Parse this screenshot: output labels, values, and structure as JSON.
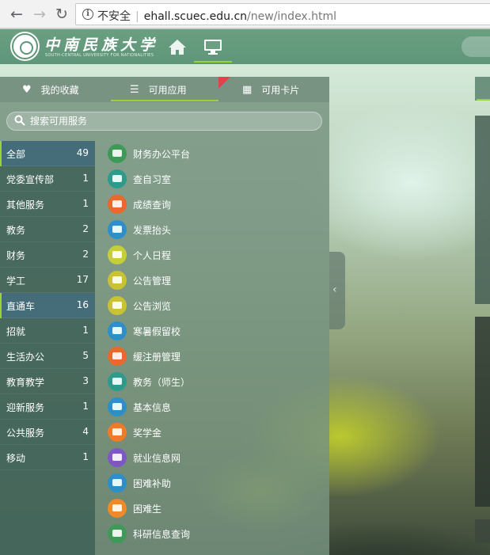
{
  "browser": {
    "security_label": "不安全",
    "url_host": "ehall.scuec.edu.cn",
    "url_path": "/new/index.html"
  },
  "header": {
    "logo_name": "中南民族大学",
    "logo_subtitle": "SOUTH-CENTRAL UNIVERSITY FOR NATIONALITIES",
    "accent_color": "#9ad23c"
  },
  "tabs": [
    {
      "label": "我的收藏",
      "icon": "heart-icon"
    },
    {
      "label": "可用应用",
      "icon": "list-icon",
      "active": true
    },
    {
      "label": "可用卡片",
      "icon": "grid-icon"
    }
  ],
  "search": {
    "placeholder": "搜索可用服务"
  },
  "categories": [
    {
      "name": "全部",
      "count": "49"
    },
    {
      "name": "党委宣传部",
      "count": "1"
    },
    {
      "name": "其他服务",
      "count": "1"
    },
    {
      "name": "教务",
      "count": "2"
    },
    {
      "name": "财务",
      "count": "2"
    },
    {
      "name": "学工",
      "count": "17"
    },
    {
      "name": "直通车",
      "count": "16"
    },
    {
      "name": "招就",
      "count": "1"
    },
    {
      "name": "生活办公",
      "count": "5"
    },
    {
      "name": "教育教学",
      "count": "3"
    },
    {
      "name": "迎新服务",
      "count": "1"
    },
    {
      "name": "公共服务",
      "count": "4"
    },
    {
      "name": "移动",
      "count": "1"
    }
  ],
  "apps": [
    {
      "label": "财务办公平台",
      "color": "#3f9a57"
    },
    {
      "label": "查自习室",
      "color": "#2e9a8c"
    },
    {
      "label": "成绩查询",
      "color": "#e8682e"
    },
    {
      "label": "发票抬头",
      "color": "#2e8fc8"
    },
    {
      "label": "个人日程",
      "color": "#c6cf3a"
    },
    {
      "label": "公告管理",
      "color": "#c8c234"
    },
    {
      "label": "公告浏览",
      "color": "#c8c234"
    },
    {
      "label": "寒暑假留校",
      "color": "#2e8fc8"
    },
    {
      "label": "缓注册管理",
      "color": "#e8682e"
    },
    {
      "label": "教务（师生）",
      "color": "#2e9a8c"
    },
    {
      "label": "基本信息",
      "color": "#2e8fc8"
    },
    {
      "label": "奖学金",
      "color": "#ee7a2a"
    },
    {
      "label": "就业信息网",
      "color": "#7e57c2"
    },
    {
      "label": "困难补助",
      "color": "#2e8fc8"
    },
    {
      "label": "困难生",
      "color": "#ee8a2a"
    },
    {
      "label": "科研信息查询",
      "color": "#3f9a57"
    }
  ]
}
